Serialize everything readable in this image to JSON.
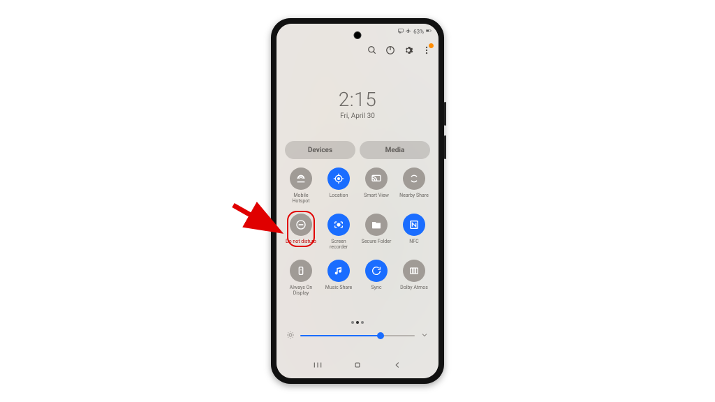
{
  "status": {
    "battery_pct": "63%",
    "airplane": "✈"
  },
  "clock": {
    "time": "2:15",
    "date": "Fri, April 30"
  },
  "pills": {
    "devices": "Devices",
    "media": "Media"
  },
  "tiles": [
    {
      "id": "mobile-hotspot",
      "label": "Mobile Hotspot",
      "on": false
    },
    {
      "id": "location",
      "label": "Location",
      "on": true
    },
    {
      "id": "smart-view",
      "label": "Smart View",
      "on": false
    },
    {
      "id": "nearby-share",
      "label": "Nearby Share",
      "on": false
    },
    {
      "id": "do-not-disturb",
      "label": "Do not disturb",
      "on": false,
      "highlight": true
    },
    {
      "id": "screen-recorder",
      "label": "Screen recorder",
      "on": true
    },
    {
      "id": "secure-folder",
      "label": "Secure Folder",
      "on": false
    },
    {
      "id": "nfc",
      "label": "NFC",
      "on": true
    },
    {
      "id": "always-on-display",
      "label": "Always On Display",
      "on": false
    },
    {
      "id": "music-share",
      "label": "Music Share",
      "on": true
    },
    {
      "id": "sync",
      "label": "Sync",
      "on": true
    },
    {
      "id": "dolby-atmos",
      "label": "Dolby Atmos",
      "on": false
    }
  ],
  "brightness": {
    "percent": 70
  }
}
